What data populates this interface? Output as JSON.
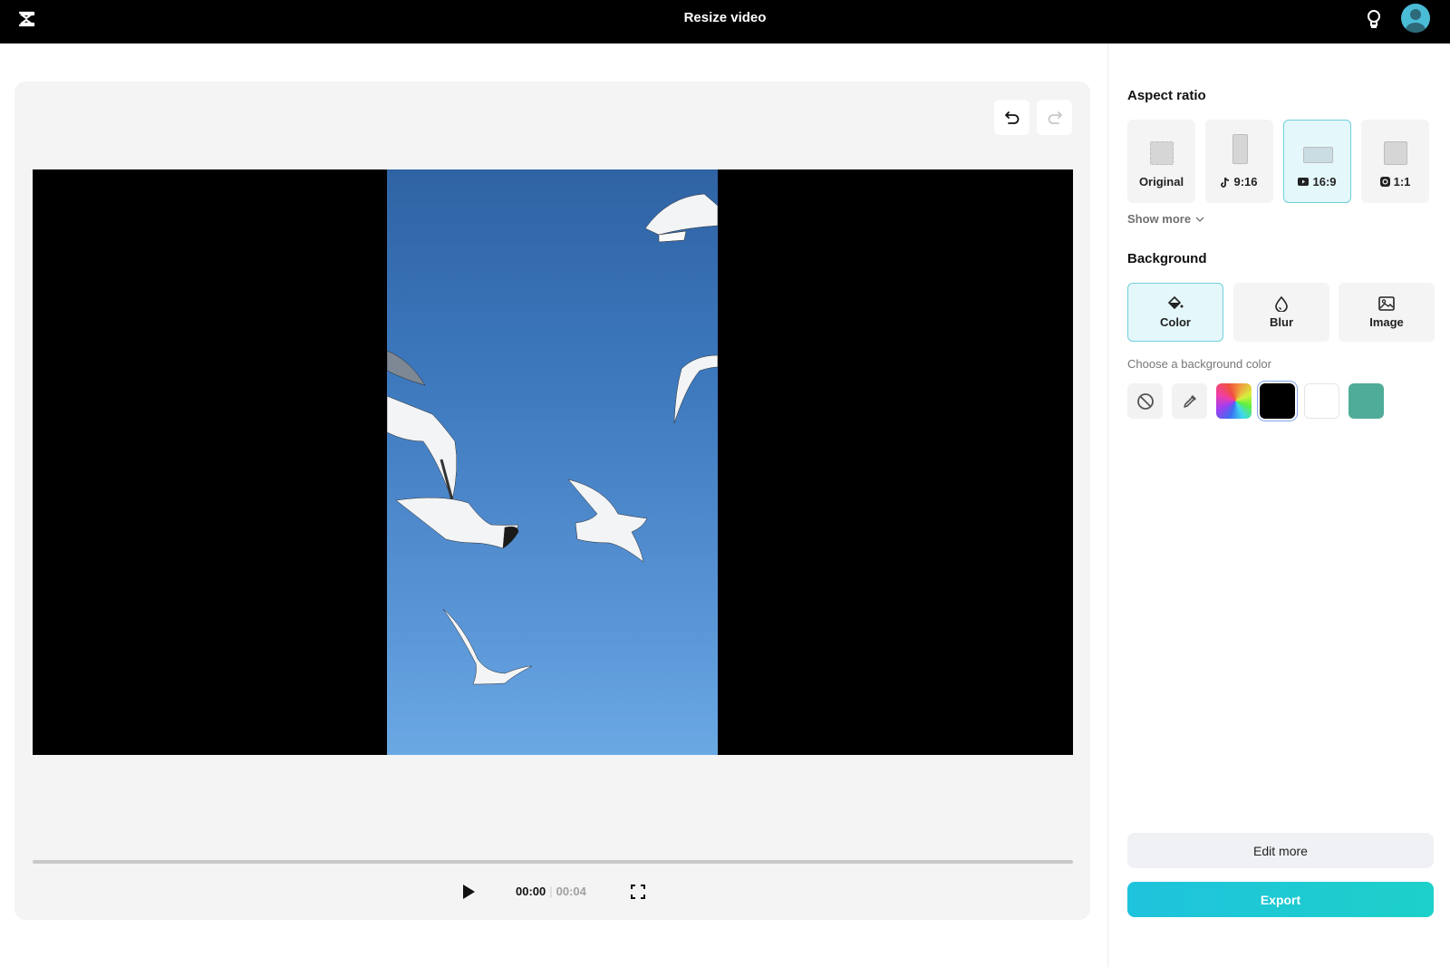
{
  "header": {
    "title": "Resize video",
    "logo_icon": "capcut-logo-icon",
    "tips_icon": "lightbulb-icon",
    "avatar_icon": "user-avatar-icon"
  },
  "editor": {
    "undo_icon": "undo-icon",
    "redo_icon": "redo-icon",
    "playback": {
      "current_time": "00:00",
      "duration": "00:04",
      "progress": 0
    },
    "colors": {
      "stage_bg": "#f4f4f4",
      "video_bg": "#000000"
    }
  },
  "panel": {
    "aspect_ratio": {
      "title": "Aspect ratio",
      "options": [
        {
          "label": "Original",
          "icon": "none",
          "selected": false
        },
        {
          "label": "9:16",
          "icon": "tiktok-icon",
          "selected": false
        },
        {
          "label": "16:9",
          "icon": "youtube-icon",
          "selected": true
        },
        {
          "label": "1:1",
          "icon": "instagram-icon",
          "selected": false
        }
      ],
      "show_more": "Show more"
    },
    "background": {
      "title": "Background",
      "options": [
        {
          "label": "Color",
          "icon": "paint-bucket-icon",
          "selected": true
        },
        {
          "label": "Blur",
          "icon": "droplet-icon",
          "selected": false
        },
        {
          "label": "Image",
          "icon": "image-icon",
          "selected": false
        }
      ],
      "hint": "Choose a background color",
      "swatches": [
        {
          "name": "none",
          "icon": "no-color-icon"
        },
        {
          "name": "eyedropper",
          "icon": "eyedropper-icon"
        },
        {
          "name": "custom-gradient",
          "color": "rainbow"
        },
        {
          "name": "black",
          "color": "#000000",
          "selected": true
        },
        {
          "name": "white",
          "color": "#ffffff"
        },
        {
          "name": "teal",
          "color": "#4fac99"
        }
      ]
    },
    "actions": {
      "edit_more": "Edit more",
      "export": "Export"
    },
    "accent_color": "#1fc3dd"
  }
}
